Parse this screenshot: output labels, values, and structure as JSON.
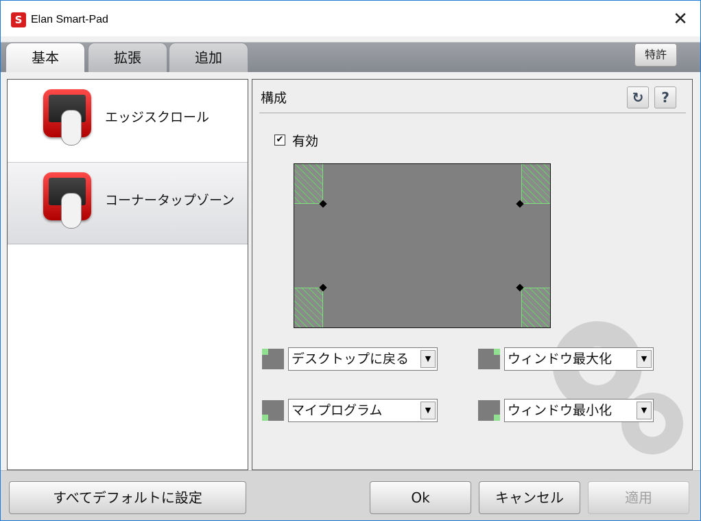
{
  "window": {
    "title": "Elan Smart-Pad",
    "app_icon": "elan-logo-icon",
    "close_label": "✕"
  },
  "tabs": [
    {
      "label": "基本",
      "active": true
    },
    {
      "label": "拡張",
      "active": false
    },
    {
      "label": "追加",
      "active": false
    }
  ],
  "patent_button": "特許",
  "features": [
    {
      "label": "エッジスクロール",
      "icon": "edge-scroll-icon",
      "selected": false
    },
    {
      "label": "コーナータップゾーン",
      "icon": "corner-tap-icon",
      "selected": true
    }
  ],
  "config": {
    "title": "構成",
    "reset_icon": "refresh-icon",
    "help_label": "?",
    "enabled_label": "有効",
    "enabled": true
  },
  "zones": {
    "top_left": "デスクトップに戻る",
    "top_right": "ウィンドウ最大化",
    "bottom_left": "マイプログラム",
    "bottom_right": "ウィンドウ最小化"
  },
  "footer": {
    "defaults_label": "すべてデフォルトに設定",
    "ok_label": "Ok",
    "cancel_label": "キャンセル",
    "apply_label": "適用",
    "apply_enabled": false
  },
  "colors": {
    "accent_red": "#d71d1d",
    "zone_green": "#62d862",
    "pad_gray": "#808080"
  }
}
